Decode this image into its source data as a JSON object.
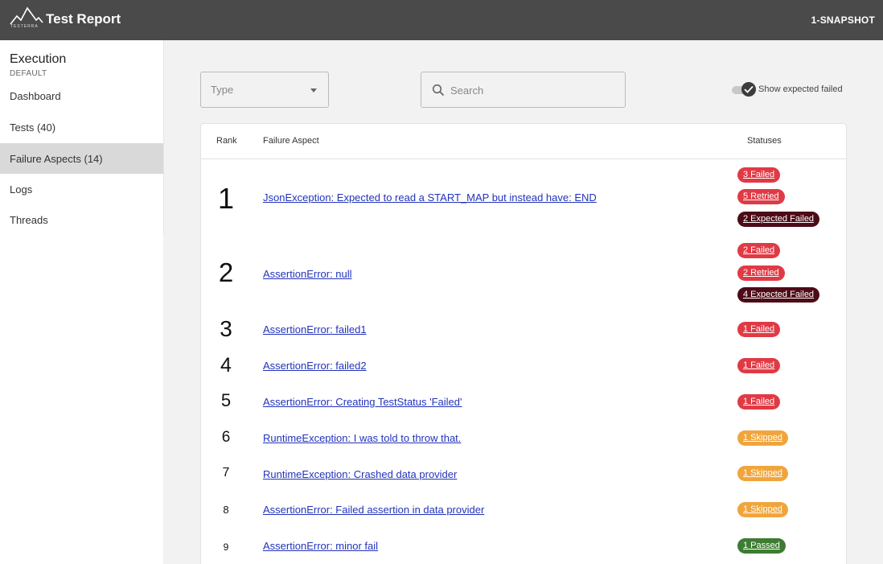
{
  "header": {
    "title": "Test Report",
    "logo_text": "TESTERRA",
    "version": "1-SNAPSHOT"
  },
  "sidebar": {
    "execution_title": "Execution",
    "execution_subtitle": "DEFAULT",
    "items": [
      {
        "label": "Dashboard"
      },
      {
        "label": "Tests (40)"
      },
      {
        "label": "Failure Aspects (14)",
        "active": true
      },
      {
        "label": "Logs"
      },
      {
        "label": "Threads"
      }
    ]
  },
  "filters": {
    "type_placeholder": "Type",
    "search_placeholder": "Search",
    "toggle_label": "Show expected failed",
    "toggle_on": true
  },
  "table": {
    "headers": {
      "rank": "Rank",
      "aspect": "Failure Aspect",
      "statuses": "Statuses"
    },
    "rows": [
      {
        "rank": "1",
        "aspect": "JsonException: Expected to read a START_MAP but instead have: END",
        "statuses": [
          {
            "label": "3 Failed",
            "kind": "failed"
          },
          {
            "label": "5 Retried",
            "kind": "retried"
          },
          {
            "label": "2 Expected Failed",
            "kind": "expected"
          }
        ]
      },
      {
        "rank": "2",
        "aspect": "AssertionError: null",
        "statuses": [
          {
            "label": "2 Failed",
            "kind": "failed"
          },
          {
            "label": "2 Retried",
            "kind": "retried"
          },
          {
            "label": "4 Expected Failed",
            "kind": "expected"
          }
        ]
      },
      {
        "rank": "3",
        "aspect": "AssertionError: failed1",
        "statuses": [
          {
            "label": "1 Failed",
            "kind": "failed"
          }
        ]
      },
      {
        "rank": "4",
        "aspect": "AssertionError: failed2",
        "statuses": [
          {
            "label": "1 Failed",
            "kind": "failed"
          }
        ]
      },
      {
        "rank": "5",
        "aspect": "AssertionError: Creating TestStatus 'Failed'",
        "statuses": [
          {
            "label": "1 Failed",
            "kind": "failed"
          }
        ]
      },
      {
        "rank": "6",
        "aspect": "RuntimeException: I was told to throw that.",
        "statuses": [
          {
            "label": "1 Skipped",
            "kind": "skipped"
          }
        ]
      },
      {
        "rank": "7",
        "aspect": "RuntimeException: Crashed data provider",
        "statuses": [
          {
            "label": "1 Skipped",
            "kind": "skipped"
          }
        ]
      },
      {
        "rank": "8",
        "aspect": "AssertionError: Failed assertion in data provider",
        "statuses": [
          {
            "label": "1 Skipped",
            "kind": "skipped"
          }
        ]
      },
      {
        "rank": "9",
        "aspect": "AssertionError: minor fail",
        "statuses": [
          {
            "label": "1 Passed",
            "kind": "passed"
          }
        ]
      }
    ]
  }
}
